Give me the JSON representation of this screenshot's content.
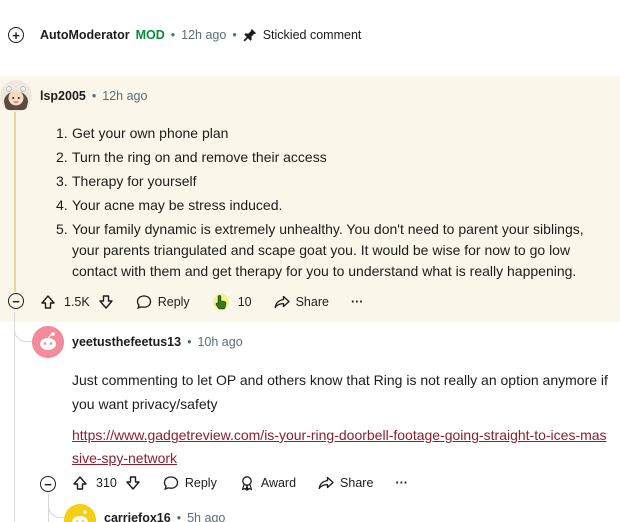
{
  "top_comment": {
    "username": "AutoModerator",
    "badge": "MOD",
    "separator": "•",
    "time": "12h ago",
    "stickied_label": "Stickied comment",
    "colors": {
      "badge": "#0a8a3a"
    }
  },
  "comment1": {
    "username": "lsp2005",
    "time": "12h ago",
    "items": [
      {
        "num": "1.",
        "text": "Get your own phone plan"
      },
      {
        "num": "2.",
        "text": "Turn the ring on and remove their access"
      },
      {
        "num": "3.",
        "text": "Therapy for yourself"
      },
      {
        "num": "4.",
        "text": "Your acne may be stress induced."
      },
      {
        "num": "5.",
        "text": "Your family dynamic is extremely unhealthy. You don't need to parent your siblings, your parents triangulated and scape goat you. It would be wise for now to go low contact with them and get therapy for you to understand what is really happening."
      }
    ],
    "actions": {
      "votes": "1.5K",
      "reply": "Reply",
      "award_count": "10",
      "share": "Share",
      "more": "···"
    },
    "colors": {
      "highlight": "#fbf6ea"
    }
  },
  "comment2": {
    "username": "yeetusthefeetus13",
    "time": "10h ago",
    "text": "Just commenting to let OP and others know that Ring is not really an option anymore if you want privacy/safety",
    "link": "https://www.gadgetreview.com/is-your-ring-doorbell-footage-going-straight-to-ices-massive-spy-network",
    "actions": {
      "votes": "310",
      "reply": "Reply",
      "award": "Award",
      "share": "Share",
      "more": "···"
    }
  },
  "comment3": {
    "username": "carriefox16",
    "time": "5h ago"
  }
}
